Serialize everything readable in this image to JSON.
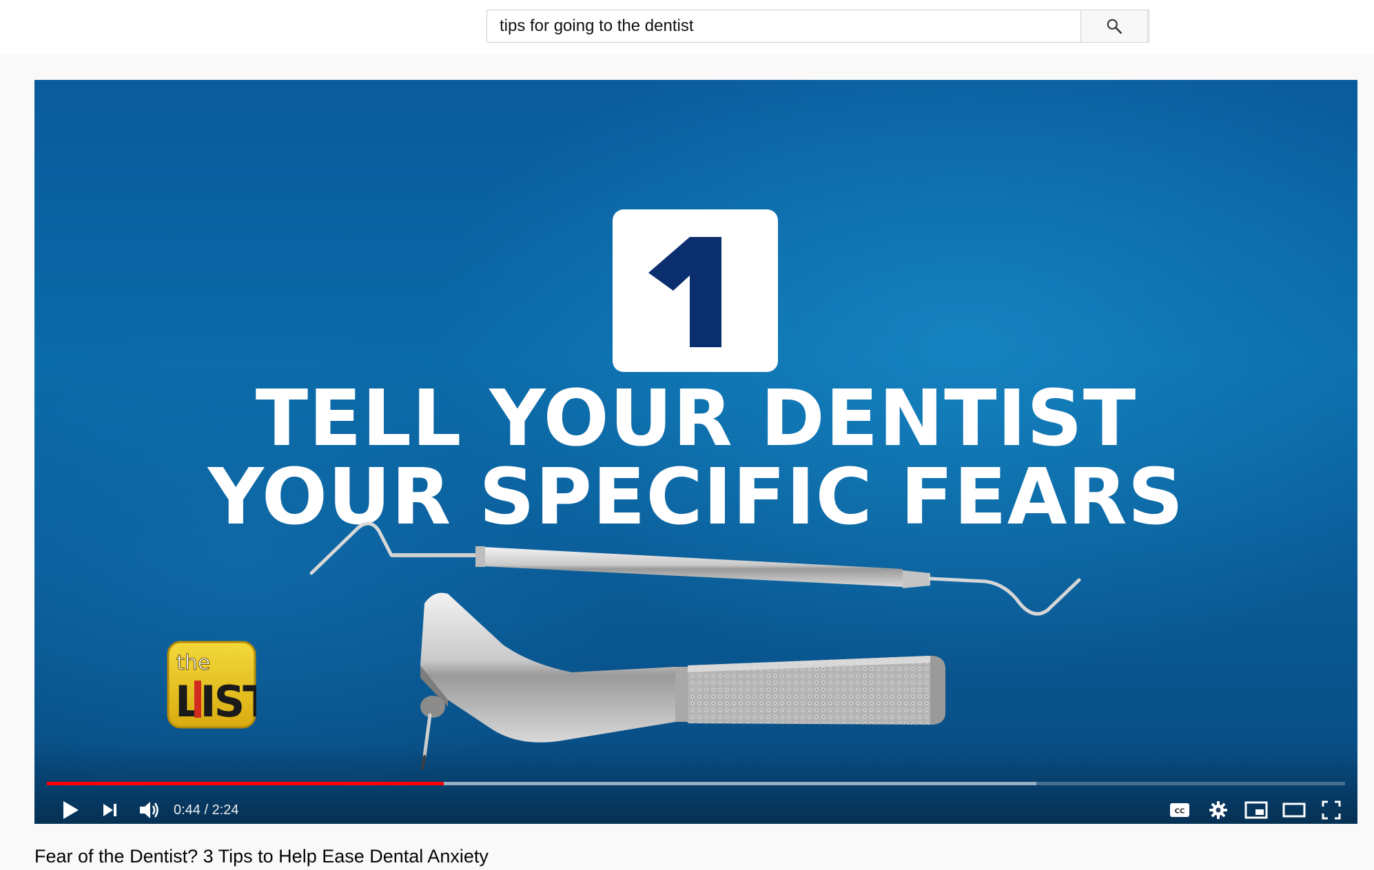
{
  "search": {
    "query": "tips for going to the dentist"
  },
  "video": {
    "card_number": "1",
    "headline_line1": "TELL YOUR DENTIST",
    "headline_line2": "YOUR SPECIFIC FEARS",
    "logo_the": "the",
    "logo_list": "LIST",
    "played_fraction": 0.3056,
    "buffered_fraction": 0.762,
    "time": "0:44 / 2:24"
  },
  "icons": {
    "search": "search-icon",
    "play": "play-icon",
    "next": "next-icon",
    "volume": "volume-icon",
    "captions": "cc-icon",
    "settings": "gear-icon",
    "miniplayer": "miniplayer-icon",
    "theater": "theater-mode-icon",
    "fullscreen": "fullscreen-icon"
  },
  "colors": {
    "progress": "#ff0000",
    "card_number": "#0b2f6e",
    "logo_yellow": "#e9c61a"
  },
  "title": "Fear of the Dentist? 3 Tips to Help Ease Dental Anxiety"
}
